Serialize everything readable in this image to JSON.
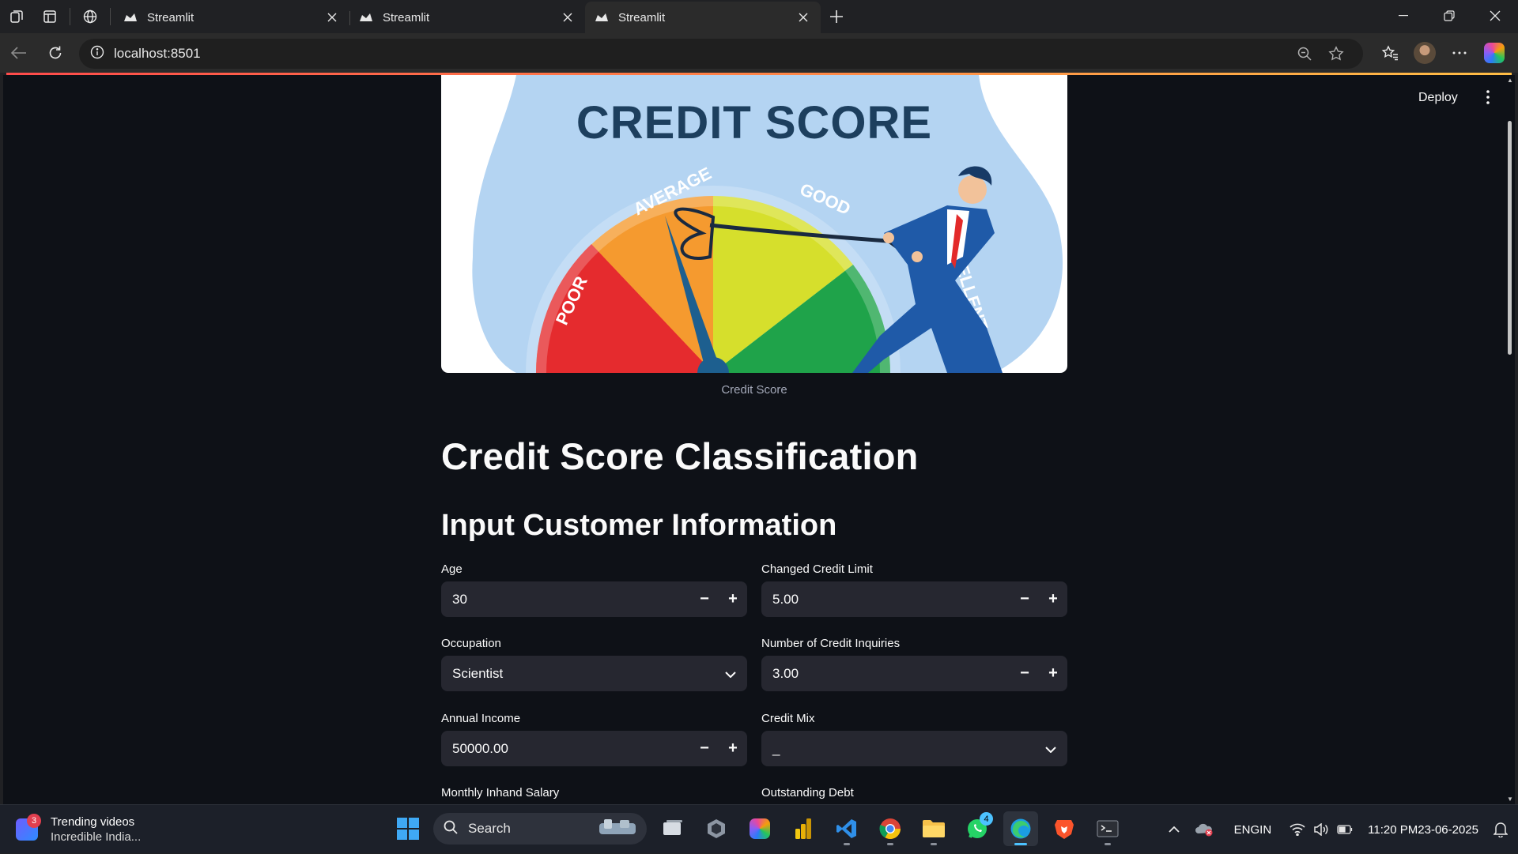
{
  "browser": {
    "tabs": [
      {
        "title": "Streamlit",
        "active": false
      },
      {
        "title": "Streamlit",
        "active": false
      },
      {
        "title": "Streamlit",
        "active": true
      }
    ],
    "url": "localhost:8501"
  },
  "app": {
    "deploy_label": "Deploy",
    "hero": {
      "heading": "CREDIT SCORE",
      "gauge_labels": [
        "POOR",
        "AVERAGE",
        "GOOD",
        "EXCELLENT"
      ],
      "caption": "Credit Score"
    },
    "title": "Credit Score Classification",
    "subtitle": "Input Customer Information",
    "fields": {
      "age": {
        "label": "Age",
        "value": "30"
      },
      "changed_credit_limit": {
        "label": "Changed Credit Limit",
        "value": "5.00"
      },
      "occupation": {
        "label": "Occupation",
        "value": "Scientist"
      },
      "num_credit_inquiries": {
        "label": "Number of Credit Inquiries",
        "value": "3.00"
      },
      "annual_income": {
        "label": "Annual Income",
        "value": "50000.00"
      },
      "credit_mix": {
        "label": "Credit Mix",
        "value": "_"
      },
      "monthly_inhand_salary": {
        "label": "Monthly Inhand Salary"
      },
      "outstanding_debt": {
        "label": "Outstanding Debt"
      }
    },
    "stepper": {
      "minus": "−",
      "plus": "+"
    }
  },
  "taskbar": {
    "widget": {
      "badge": "3",
      "line1": "Trending videos",
      "line2": "Incredible India..."
    },
    "search_label": "Search",
    "whatsapp_badge": "4",
    "lang": {
      "line1": "ENG",
      "line2": "IN"
    },
    "time": "11:20 PM",
    "date": "23-06-2025"
  }
}
